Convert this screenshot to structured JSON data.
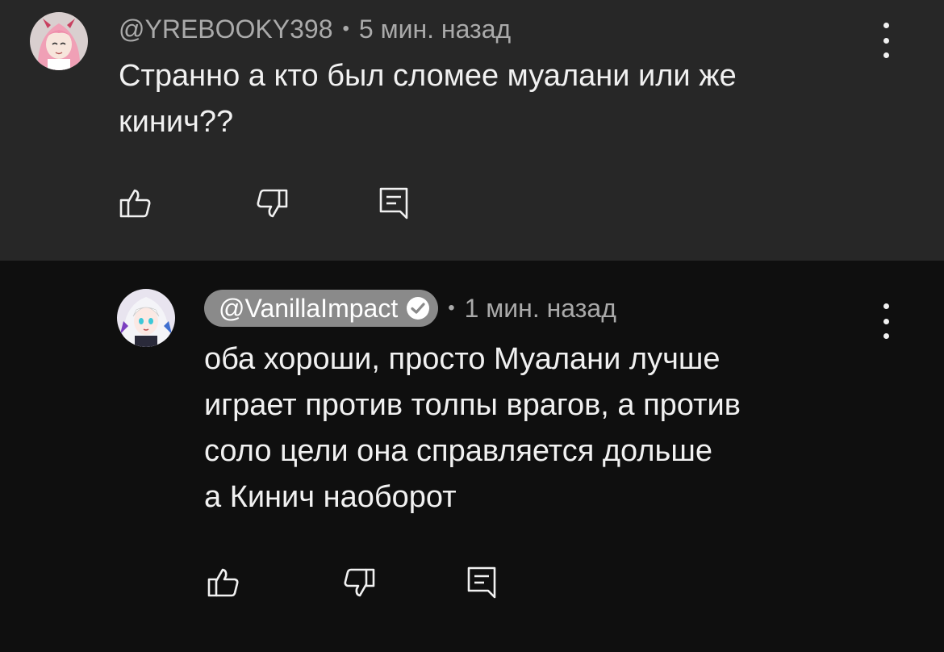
{
  "comments": [
    {
      "author": "@YREBOOKY398",
      "separator": "•",
      "time": "5 мин. назад",
      "text_lines": [
        "Странно а кто был сломее муалани или же",
        "кинич??"
      ],
      "avatar_icon": "anime-avatar-pink-hair",
      "menu_icon": "more-vertical-icon",
      "actions": [
        "like-icon",
        "dislike-icon",
        "reply-icon"
      ]
    },
    {
      "author": "@VanillaImpact",
      "author_verified": true,
      "separator": "•",
      "time": "1 мин. назад",
      "text_lines": [
        "оба хороши, просто Муалани лучше",
        "играет против толпы врагов, а против",
        "соло цели она справляется дольше",
        "а Кинич наоборот"
      ],
      "avatar_icon": "anime-avatar-white-hair",
      "menu_icon": "more-vertical-icon",
      "actions": [
        "like-icon",
        "dislike-icon",
        "reply-icon"
      ]
    }
  ],
  "colors": {
    "background": "#0f0f0f",
    "highlight_background": "#272727",
    "text": "#f1f1f1",
    "meta_text": "#aaaaaa",
    "author_pill": "#8a8a8a"
  }
}
